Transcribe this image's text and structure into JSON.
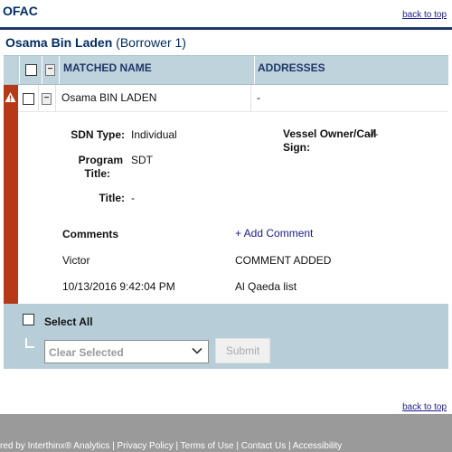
{
  "header": {
    "title": "OFAC",
    "back_to_top": "back to top"
  },
  "borrower": {
    "name": "Osama Bin Laden",
    "role": "(Borrower 1)"
  },
  "table": {
    "columns": [
      "MATCHED NAME",
      "ADDRESSES"
    ],
    "row": {
      "matched_name": "Osama BIN LADEN",
      "address": "-"
    }
  },
  "details": {
    "sdn_type_label": "SDN Type:",
    "sdn_type_value": "Individual",
    "program_title_label_line1": "Program",
    "program_title_label_line2": "Title:",
    "program_title_value": "SDT",
    "title_label": "Title:",
    "title_value": "-",
    "vessel_label_line1": "Vessel Owner/Call",
    "vessel_label_line2": "Sign:",
    "vessel_value": "-/-"
  },
  "comments": {
    "heading": "Comments",
    "add_comment": "+ Add Comment",
    "author": "Victor",
    "status": "COMMENT ADDED",
    "timestamp": "10/13/2016 9:42:04 PM",
    "text": "Al Qaeda list"
  },
  "actions": {
    "select_all": "Select All",
    "dropdown_value": "Clear Selected",
    "submit": "Submit"
  },
  "footer": {
    "back_to_top": "back to top",
    "copyright": "red by Interthinx® Analytics | Privacy Policy | Terms of Use | Contact Us | Accessibility"
  },
  "colors": {
    "navy": "#1e3767",
    "alert_red": "#b63a18",
    "header_row": "#bfd3dd",
    "panel_blue": "#b7cdd8"
  }
}
